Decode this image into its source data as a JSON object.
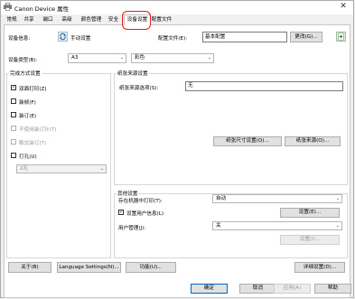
{
  "window": {
    "title": "Canon Device 属性",
    "close_glyph": "✕",
    "app_icon": "printer-icon"
  },
  "tabs": [
    "常规",
    "共享",
    "端口",
    "高级",
    "颜色管理",
    "安全",
    "设备设置",
    "配置文件"
  ],
  "active_tab": "设备设置",
  "device_info": {
    "label": "设备信息:",
    "refresh_icon": "refresh-icon",
    "mode": "手动设置",
    "profile_label": "配置文件(E):",
    "profile_value": "基本配置",
    "change_button": "更改(G)...",
    "add_icon": "add-profile-icon"
  },
  "device_type": {
    "label": "设备类型(B):",
    "paper_value": "A3",
    "color_value": "彩色"
  },
  "finishing": {
    "title": "完成方式设置",
    "items": [
      {
        "label": "双面打印(Z)",
        "checked": true,
        "disabled": false
      },
      {
        "label": "装帧(F)",
        "checked": false,
        "disabled": false
      },
      {
        "label": "装订(E)",
        "checked": false,
        "disabled": false
      },
      {
        "label": "不使用装订针(T)",
        "checked": false,
        "disabled": true
      },
      {
        "label": "鞍式装订(T)",
        "checked": false,
        "disabled": true
      },
      {
        "label": "打孔(U)",
        "checked": false,
        "disabled": false
      }
    ],
    "punch_value": "2孔"
  },
  "paper_source": {
    "title": "纸张来源设置",
    "option_label": "纸张来源选项(S):",
    "option_value": "无",
    "size_button": "纸张尺寸设置(Q)...",
    "source_button": "纸张来源(O)..."
  },
  "other": {
    "title": "其他设置",
    "storage_label": "存在机器中打印(T):",
    "storage_value": "自动",
    "user_info_label": "设置用户信息(L)",
    "user_info_checked": true,
    "settings_button": "设置(E)...",
    "user_mgmt_label": "用户管理(J):",
    "user_mgmt_value": "关",
    "user_mgmt_button": "设置(I)..."
  },
  "bottom_buttons": {
    "about": "关于(B)",
    "language": "Language Settings(N)...",
    "function": "功能(U)...",
    "details": "详细设置(D)..."
  },
  "dialog_buttons": {
    "ok": "确定",
    "cancel": "取消",
    "apply": "应用(A)",
    "help": "帮助"
  },
  "colors": {
    "highlight": "#e21b1b",
    "accent": "#0067c0"
  }
}
